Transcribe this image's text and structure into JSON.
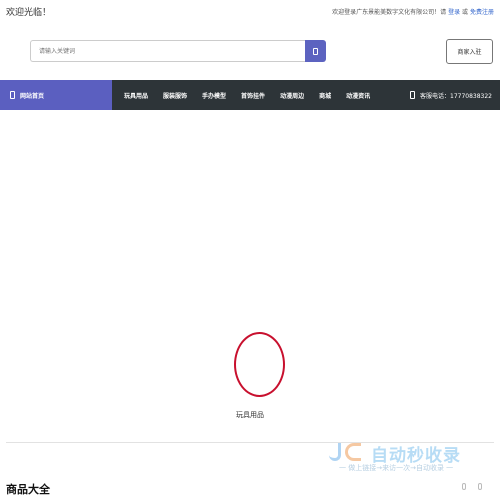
{
  "header": {
    "welcome": "欢迎光临！",
    "greeting": "欢迎登录广东景能美数字文化有限公司！请",
    "login": "登录",
    "or": "或",
    "register": "免费注册"
  },
  "search": {
    "placeholder": "请输入关键词",
    "icon": "search-icon"
  },
  "merchant_button": "商家入驻",
  "nav": {
    "home": "网站首页",
    "items": [
      "玩具用品",
      "服装服饰",
      "手办模型",
      "首饰挂件",
      "动漫周边",
      "商城",
      "动漫资讯"
    ],
    "service_label": "客服电话：17770838322"
  },
  "category_card": {
    "label": "玩具用品",
    "ring_color": "#c8102e"
  },
  "section": {
    "title": "商品大全"
  },
  "watermark": {
    "title": "自动秒收录",
    "subtitle": "一 做上链接→来访一次→自动收录 一"
  },
  "colors": {
    "accent": "#5b5fc0",
    "nav_bg": "#2d3438",
    "link": "#3366cc"
  }
}
